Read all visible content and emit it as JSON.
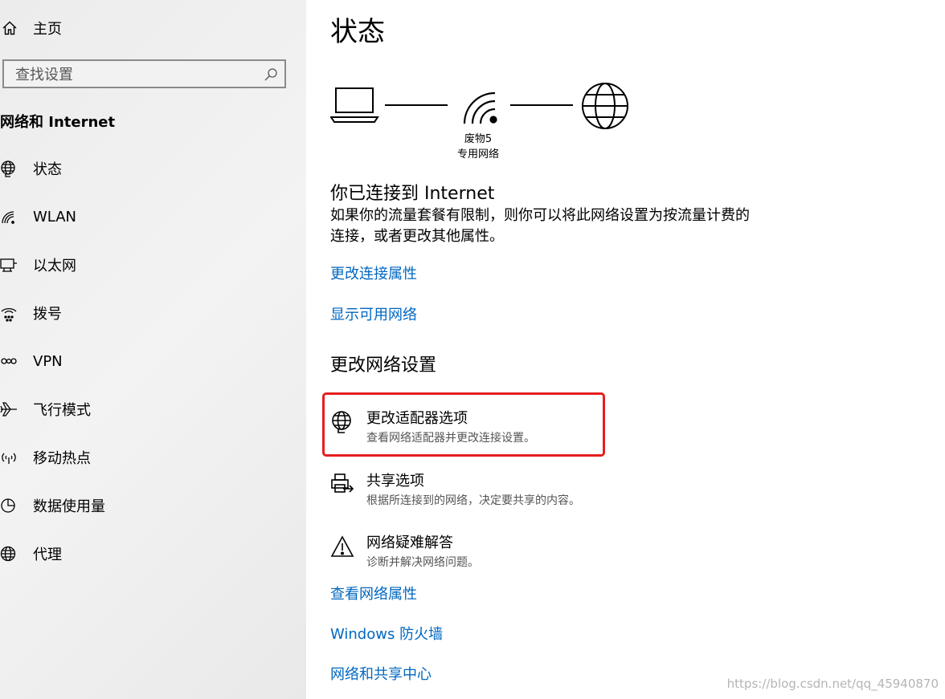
{
  "sidebar": {
    "home_label": "主页",
    "search_placeholder": "查找设置",
    "section_title": "网络和 Internet",
    "items": [
      {
        "label": "状态",
        "icon": "globe-status-icon"
      },
      {
        "label": "WLAN",
        "icon": "wifi-icon"
      },
      {
        "label": "以太网",
        "icon": "ethernet-icon"
      },
      {
        "label": "拨号",
        "icon": "dialup-icon"
      },
      {
        "label": "VPN",
        "icon": "vpn-icon"
      },
      {
        "label": "飞行模式",
        "icon": "airplane-icon"
      },
      {
        "label": "移动热点",
        "icon": "hotspot-icon"
      },
      {
        "label": "数据使用量",
        "icon": "data-usage-icon"
      },
      {
        "label": "代理",
        "icon": "proxy-globe-icon"
      }
    ]
  },
  "main": {
    "title": "状态",
    "network": {
      "name": "废物5",
      "type": "专用网络"
    },
    "connected_heading": "你已连接到 Internet",
    "connected_desc": "如果你的流量套餐有限制，则你可以将此网络设置为按流量计费的连接，或者更改其他属性。",
    "link_change_props": "更改连接属性",
    "link_show_networks": "显示可用网络",
    "change_heading": "更改网络设置",
    "options": [
      {
        "title": "更改适配器选项",
        "desc": "查看网络适配器并更改连接设置。",
        "icon": "adapter-icon"
      },
      {
        "title": "共享选项",
        "desc": "根据所连接到的网络，决定要共享的内容。",
        "icon": "sharing-icon"
      },
      {
        "title": "网络疑难解答",
        "desc": "诊断并解决网络问题。",
        "icon": "warning-icon"
      }
    ],
    "link_view_props": "查看网络属性",
    "link_firewall": "Windows 防火墙",
    "link_sharing_center": "网络和共享中心"
  },
  "watermark": "https://blog.csdn.net/qq_45940870",
  "colors": {
    "accent": "#0067c0",
    "highlight": "#e51e1e",
    "sidebar_bg": "#efefef"
  }
}
